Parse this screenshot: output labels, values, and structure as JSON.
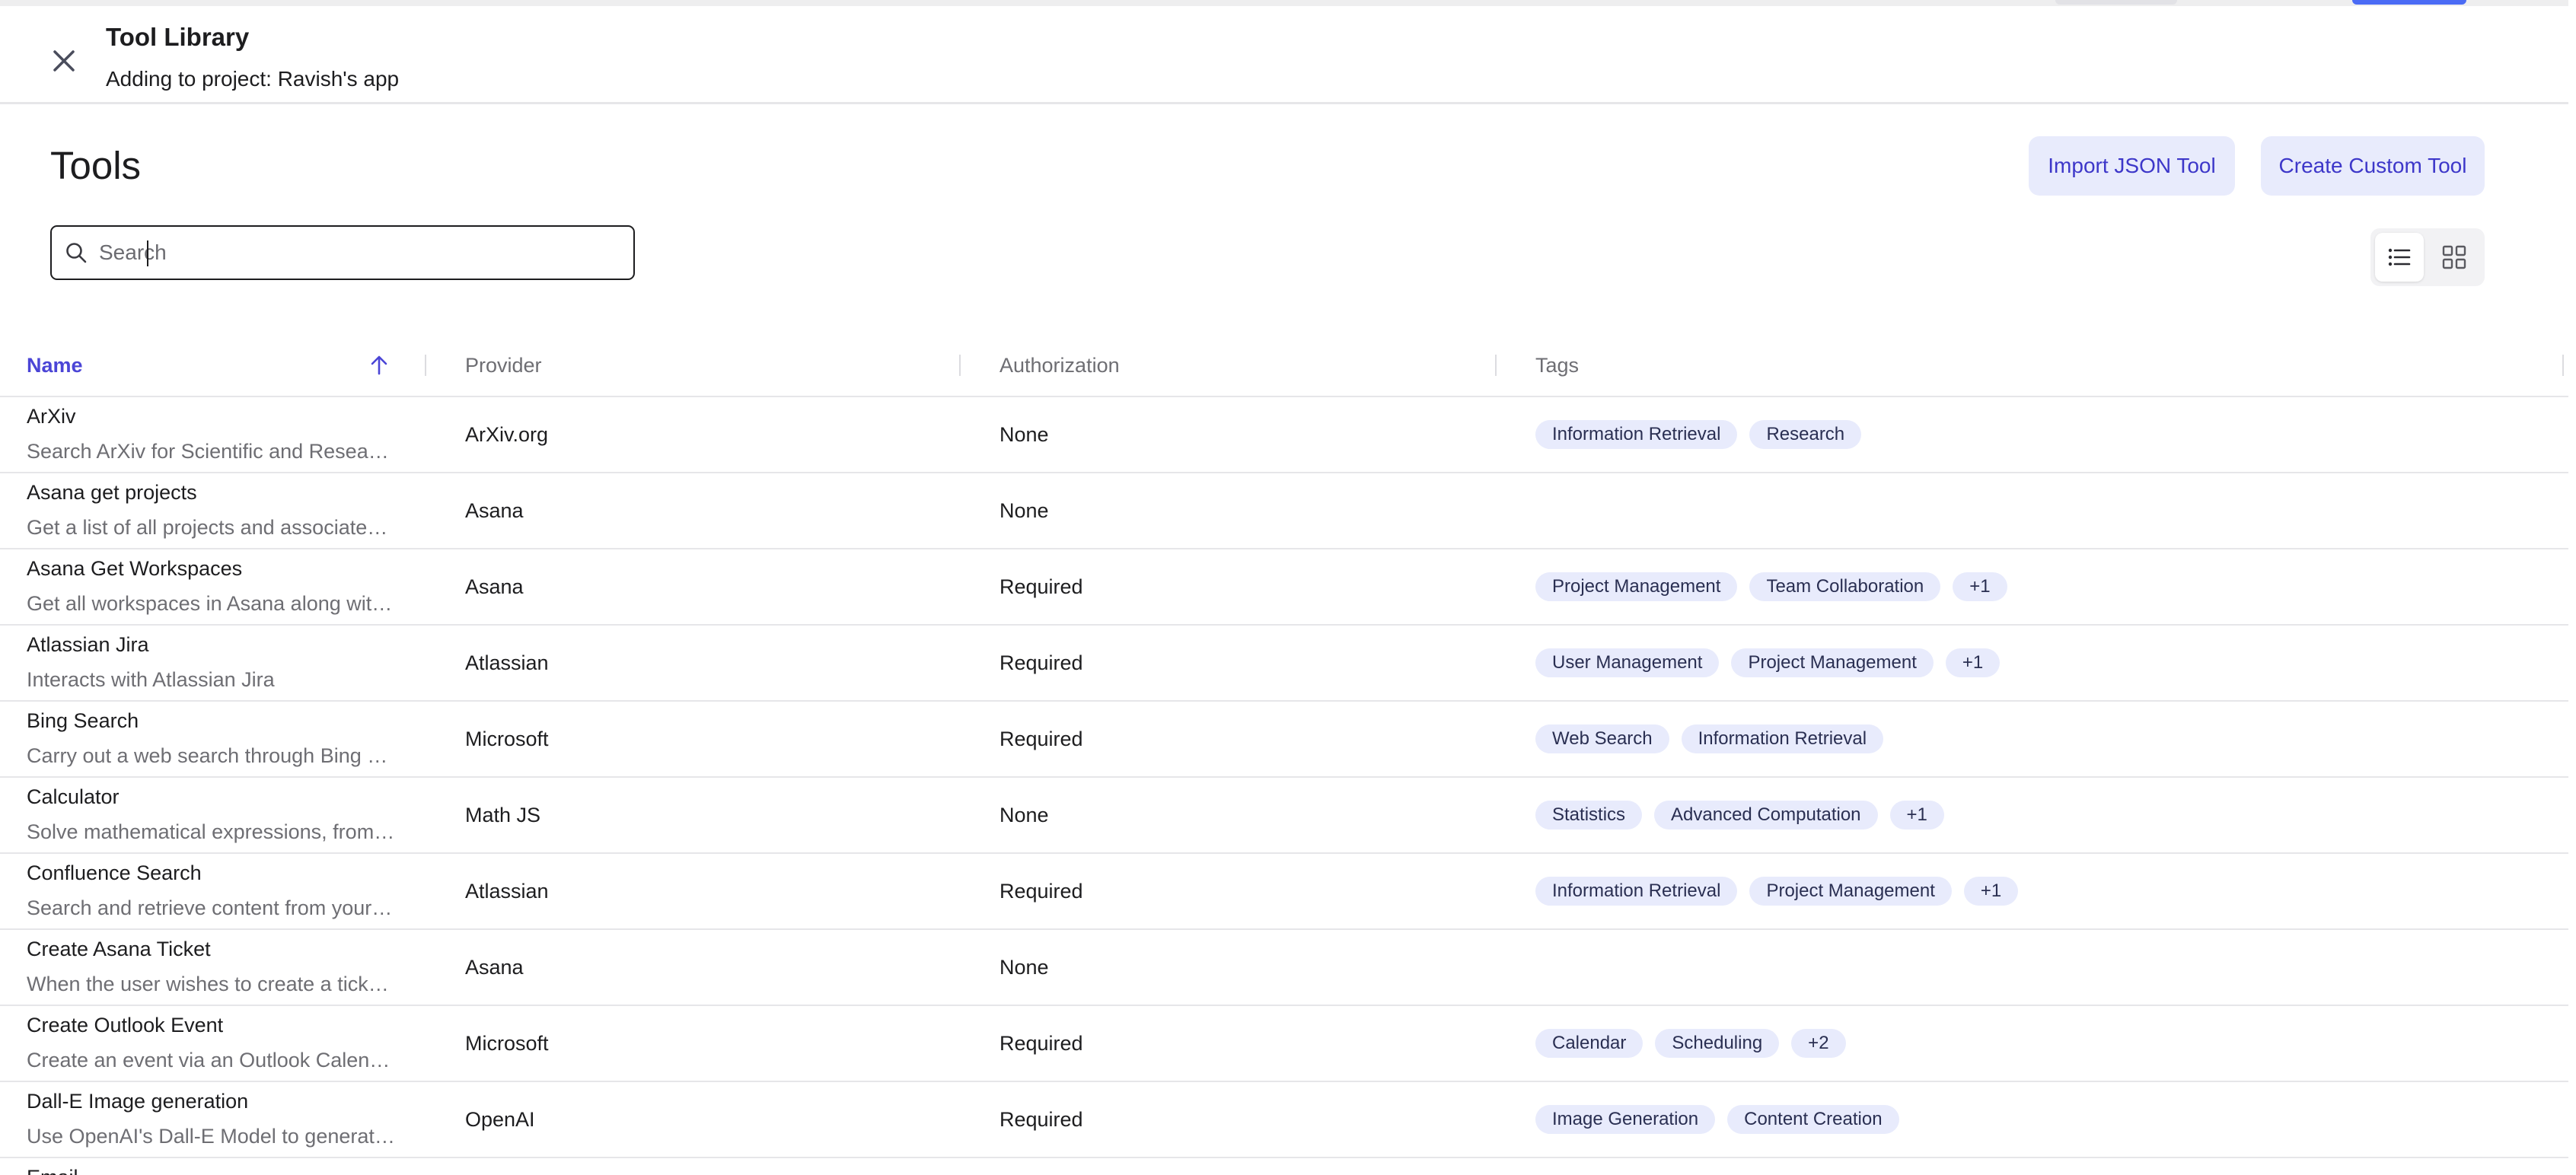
{
  "header": {
    "title": "Tool Library",
    "subtitle": "Adding to project: Ravish's app"
  },
  "page": {
    "title": "Tools",
    "import_label": "Import JSON Tool",
    "create_label": "Create Custom Tool"
  },
  "search": {
    "placeholder": "Search",
    "value": ""
  },
  "view_toggle": {
    "selected": "list",
    "options": [
      "list",
      "grid"
    ]
  },
  "table": {
    "columns": {
      "name": "Name",
      "provider": "Provider",
      "authorization": "Authorization",
      "tags": "Tags"
    },
    "sort": {
      "column": "name",
      "direction": "ascending"
    },
    "rows": [
      {
        "name": "ArXiv",
        "description": "Search ArXiv for Scientific and Research Papers",
        "provider": "ArXiv.org",
        "authorization": "None",
        "tags": [
          "Information Retrieval",
          "Research"
        ]
      },
      {
        "name": "Asana get projects",
        "description": "Get a list of all projects and associated details",
        "provider": "Asana",
        "authorization": "None",
        "tags": []
      },
      {
        "name": "Asana Get Workspaces",
        "description": "Get all workspaces in Asana along with their details",
        "provider": "Asana",
        "authorization": "Required",
        "tags": [
          "Project Management",
          "Team Collaboration",
          "+1"
        ]
      },
      {
        "name": "Atlassian Jira",
        "description": "Interacts with Atlassian Jira",
        "provider": "Atlassian",
        "authorization": "Required",
        "tags": [
          "User Management",
          "Project Management",
          "+1"
        ]
      },
      {
        "name": "Bing Search",
        "description": "Carry out a web search through Bing and return results",
        "provider": "Microsoft",
        "authorization": "Required",
        "tags": [
          "Web Search",
          "Information Retrieval"
        ]
      },
      {
        "name": "Calculator",
        "description": "Solve mathematical expressions, from basic arithmetic",
        "provider": "Math JS",
        "authorization": "None",
        "tags": [
          "Statistics",
          "Advanced Computation",
          "+1"
        ]
      },
      {
        "name": "Confluence Search",
        "description": "Search and retrieve content from your Confluence",
        "provider": "Atlassian",
        "authorization": "Required",
        "tags": [
          "Information Retrieval",
          "Project Management",
          "+1"
        ]
      },
      {
        "name": "Create Asana Ticket",
        "description": "When the user wishes to create a ticket in Asana",
        "provider": "Asana",
        "authorization": "None",
        "tags": []
      },
      {
        "name": "Create Outlook Event",
        "description": "Create an event via an Outlook Calendar",
        "provider": "Microsoft",
        "authorization": "Required",
        "tags": [
          "Calendar",
          "Scheduling",
          "+2"
        ]
      },
      {
        "name": "Dall-E Image generation",
        "description": "Use OpenAI's Dall-E Model to generate images",
        "provider": "OpenAI",
        "authorization": "Required",
        "tags": [
          "Image Generation",
          "Content Creation"
        ]
      },
      {
        "name": "Email",
        "description": "",
        "provider": "",
        "authorization": "",
        "tags": []
      }
    ]
  },
  "colors": {
    "accent": "#4b45d6",
    "button_bg": "#e8ebfc",
    "tag_bg": "#e8ebfc",
    "border": "#e6e6e9",
    "muted_text": "#6e6e73"
  }
}
